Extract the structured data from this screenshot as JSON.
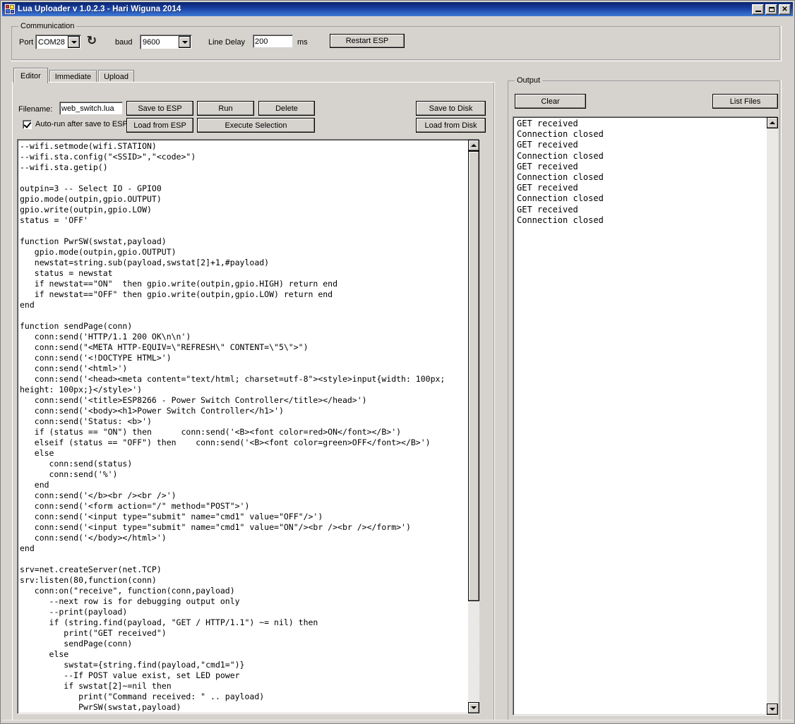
{
  "window": {
    "title": "Lua Uploader v 1.0.2.3 - Hari Wiguna 2014",
    "icon": "app-icon",
    "minimize_label": "–",
    "maximize_label": "□",
    "close_label": "✕"
  },
  "communication": {
    "group_label": "Communication",
    "port_label": "Port",
    "port_value": "COM28",
    "refresh_icon": "refresh-icon",
    "baud_label": "baud",
    "baud_value": "9600",
    "line_delay_label": "Line Delay",
    "line_delay_value": "200",
    "ms_label": "ms",
    "restart_button": "Restart ESP"
  },
  "tabs": [
    {
      "label": "Editor",
      "active": true
    },
    {
      "label": "Immediate",
      "active": false
    },
    {
      "label": "Upload",
      "active": false
    }
  ],
  "editor_toolbar": {
    "filename_label": "Filename:",
    "filename_value": "web_switch.lua",
    "autorun_label": "Auto-run after save to ESP",
    "autorun_checked": true,
    "save_to_esp": "Save to ESP",
    "run": "Run",
    "delete": "Delete",
    "load_from_esp": "Load from ESP",
    "execute_selection": "Execute Selection",
    "save_to_disk": "Save to Disk",
    "load_from_disk": "Load from Disk"
  },
  "editor": {
    "code": "--wifi.setmode(wifi.STATION)\n--wifi.sta.config(\"<SSID>\",\"<code>\")\n--wifi.sta.getip()\n\noutpin=3 -- Select IO - GPIO0\ngpio.mode(outpin,gpio.OUTPUT)\ngpio.write(outpin,gpio.LOW)\nstatus = 'OFF'\n\nfunction PwrSW(swstat,payload)\n   gpio.mode(outpin,gpio.OUTPUT)\n   newstat=string.sub(payload,swstat[2]+1,#payload)\n   status = newstat\n   if newstat==\"ON\"  then gpio.write(outpin,gpio.HIGH) return end\n   if newstat==\"OFF\" then gpio.write(outpin,gpio.LOW) return end\nend\n\nfunction sendPage(conn)\n   conn:send('HTTP/1.1 200 OK\\n\\n')\n   conn:send(\"<META HTTP-EQUIV=\\\"REFRESH\\\" CONTENT=\\\"5\\\">\")\n   conn:send('<!DOCTYPE HTML>')\n   conn:send('<html>')\n   conn:send('<head><meta content=\"text/html; charset=utf-8\"><style>input{width: 100px;\nheight: 100px;}</style>')\n   conn:send('<title>ESP8266 - Power Switch Controller</title></head>')\n   conn:send('<body><h1>Power Switch Controller</h1>')\n   conn:send('Status: <b>')\n   if (status == \"ON\") then      conn:send('<B><font color=red>ON</font></B>')\n   elseif (status == \"OFF\") then    conn:send('<B><font color=green>OFF</font></B>')\n   else\n      conn:send(status)\n      conn:send('%')\n   end\n   conn:send('</b><br /><br />')\n   conn:send('<form action=\"/\" method=\"POST\">')\n   conn:send('<input type=\"submit\" name=\"cmd1\" value=\"OFF\"/>')\n   conn:send('<input type=\"submit\" name=\"cmd1\" value=\"ON\"/><br /><br /></form>')\n   conn:send('</body></html>')\nend\n\nsrv=net.createServer(net.TCP)\nsrv:listen(80,function(conn)\n   conn:on(\"receive\", function(conn,payload)\n      --next row is for debugging output only\n      --print(payload)\n      if (string.find(payload, \"GET / HTTP/1.1\") ~= nil) then\n         print(\"GET received\")\n         sendPage(conn)\n      else\n         swstat={string.find(payload,\"cmd1=\")}\n         --If POST value exist, set LED power\n         if swstat[2]~=nil then\n            print(\"Command received: \" .. payload)\n            PwrSW(swstat,payload)"
  },
  "output": {
    "group_label": "Output",
    "clear_button": "Clear",
    "list_files_button": "List Files",
    "log": "GET received\nConnection closed\nGET received\nConnection closed\nGET received\nConnection closed\nGET received\nConnection closed\nGET received\nConnection closed"
  },
  "colors": {
    "window_face": "#d6d3ce",
    "title_gradient_start": "#0a246a",
    "title_gradient_end": "#3f7ad4",
    "field_background": "#ffffff",
    "border_dark": "#808080"
  }
}
